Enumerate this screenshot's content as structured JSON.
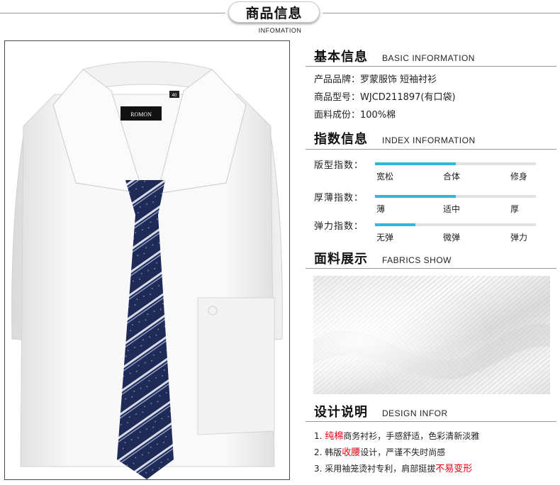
{
  "header": {
    "title": "商品信息",
    "subtitle": "INFOMATION"
  },
  "photo": {
    "brand_label": "ROMON",
    "size_label": "40"
  },
  "basic": {
    "title": "基本信息",
    "title_en": "BASIC INFORMATION",
    "rows": [
      "产品品牌：罗蒙服饰 短袖衬衫",
      "商品型号：WJCD211897(有口袋)",
      "面料成份：100%棉"
    ]
  },
  "index": {
    "title": "指数信息",
    "title_en": "INDEX INFORMATION",
    "accent_color": "#35b4e3",
    "rows": [
      {
        "label": "版型指数：",
        "level": 0.5,
        "ticks": [
          "宽松",
          "合体",
          "修身"
        ]
      },
      {
        "label": "厚薄指数：",
        "level": 0.5,
        "ticks": [
          "薄",
          "适中",
          "厚"
        ]
      },
      {
        "label": "弹力指数：",
        "level": 0.25,
        "ticks": [
          "无弹",
          "微弹",
          "弹力"
        ]
      }
    ]
  },
  "fabric": {
    "title": "面料展示",
    "title_en": "FABRICS SHOW"
  },
  "design": {
    "title": "设计说明",
    "title_en": "DESIGN INFOR",
    "highlight_color": "#e60012",
    "items": [
      {
        "prefix": "1. ",
        "highlight": "纯棉",
        "rest": "商务衬衫，手感舒适，色彩清新淡雅"
      },
      {
        "prefix": "2. 韩版",
        "highlight": "收腰",
        "rest": "设计，严谨不失时尚感"
      },
      {
        "prefix": "3. 采用袖笼烫衬专利，肩部挺拔",
        "highlight": "不易变形",
        "rest": ""
      }
    ]
  }
}
